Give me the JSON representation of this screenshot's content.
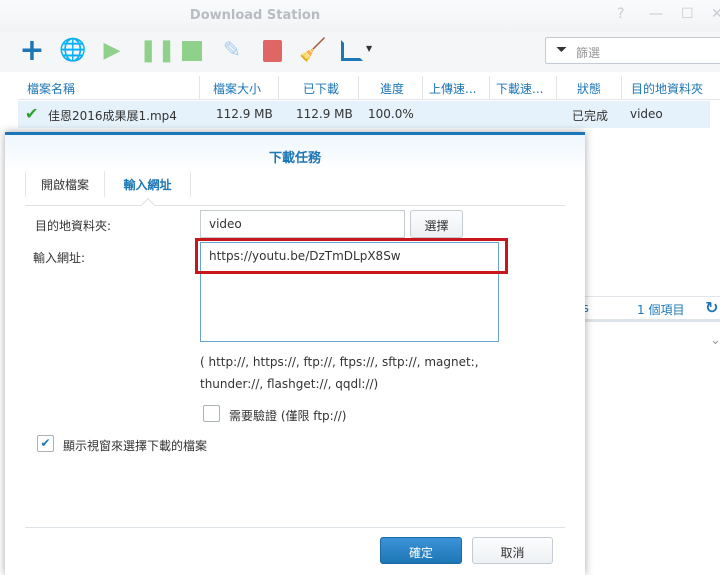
{
  "app": {
    "title": "Download Station"
  },
  "window_controls": {
    "help": "?",
    "minimize": "—",
    "maximize": "☐",
    "close": "✕"
  },
  "toolbar": {
    "filter_placeholder": "篩選"
  },
  "grid": {
    "columns": [
      "檔案名稱",
      "檔案大小",
      "已下載",
      "進度",
      "上傳速...",
      "下載速...",
      "狀態",
      "目的地資料夾"
    ],
    "rows": [
      {
        "name": "佳恩2016成果展1.mp4",
        "size": "112.9 MB",
        "downloaded": "112.9 MB",
        "progress": "100.0%",
        "upload": "",
        "download": "",
        "status": "已完成",
        "destination": "video"
      }
    ]
  },
  "statusbar": {
    "speed": "es/s",
    "count": "1 個項目"
  },
  "dialog": {
    "title": "下載任務",
    "tabs": [
      "開啟檔案",
      "輸入網址"
    ],
    "dest_label": "目的地資料夾:",
    "dest_value": "video",
    "choose_button": "選擇",
    "url_label": "輸入網址:",
    "url_value": "https://youtu.be/DzTmDLpX8Sw",
    "hint_line1": "( http://, https://, ftp://, ftps://, sftp://, magnet:,",
    "hint_line2": "thunder://, flashget://, qqdl://)",
    "auth_label": "需要驗證 (僅限 ftp://)",
    "auth_checked": false,
    "show_window_label": "顯示視窗來選擇下載的檔案",
    "show_window_checked": true,
    "ok_button": "確定",
    "cancel_button": "取消"
  },
  "colors": {
    "accent": "#1d76b5",
    "highlight": "#c8161d"
  }
}
